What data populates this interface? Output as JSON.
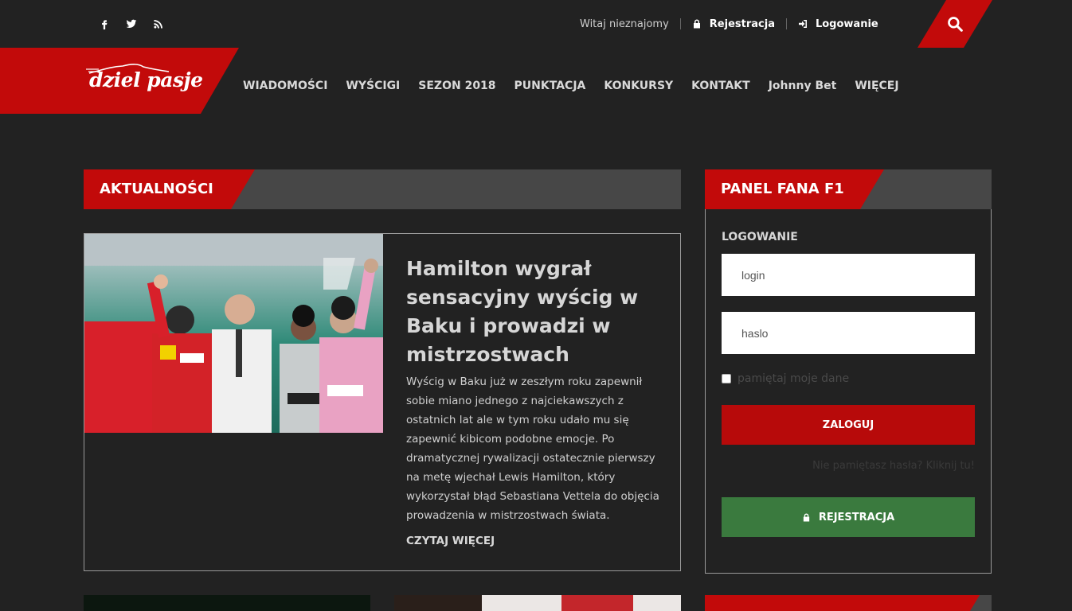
{
  "colors": {
    "accent": "#c20a0a",
    "green": "#3a7a3e",
    "background": "#222222",
    "bar": "#474747"
  },
  "topbar": {
    "social": [
      "facebook-icon",
      "twitter-icon",
      "rss-icon"
    ],
    "greeting": "Witaj nieznajomy",
    "register": "Rejestracja",
    "login": "Logowanie"
  },
  "header": {
    "logo": "dziel pasje",
    "nav": [
      "WIADOMOŚCI",
      "WYŚCIGI",
      "SEZON 2018",
      "PUNKTACJA",
      "KONKURSY",
      "KONTAKT",
      "Johnny Bet",
      "WIĘCEJ"
    ]
  },
  "news": {
    "section_title": "AKTUALNOŚCI",
    "article": {
      "title": "Hamilton wygrał sensacyjny wyścig w Baku i prowadzi w mistrzostwach",
      "body": "Wyścig w Baku już w zeszłym roku zapewnił sobie miano jednego z najciekawszych z ostatnich lat ale w tym roku udało mu się zapewnić kibicom podobne emocje. Po dramatycznej rywalizacji ostatecznie pierwszy na metę wjechał Lewis Hamilton, który wykorzystał błąd Sebastiana Vettela do objęcia prowadzenia w mistrzostwach świata.",
      "read_more": "CZYTAJ WIĘCEJ"
    }
  },
  "panel": {
    "title": "PANEL FANA F1",
    "login_label": "LOGOWANIE",
    "login_placeholder": "login",
    "password_placeholder": "haslo",
    "remember": "pamiętaj moje dane",
    "submit": "ZALOGUJ",
    "forgot": "Nie pamiętasz hasła? Kliknij tu!",
    "register": "REJESTRACJA"
  }
}
